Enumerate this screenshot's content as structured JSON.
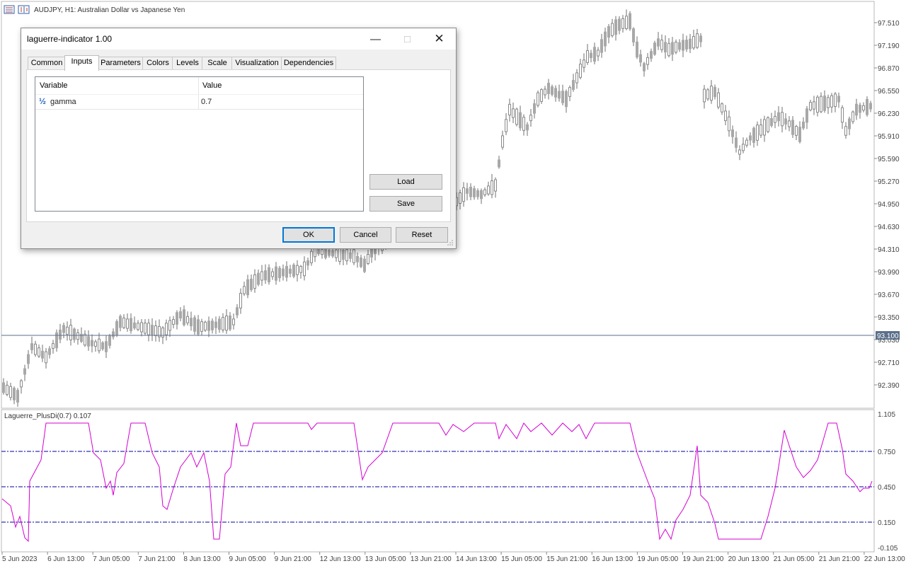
{
  "chart": {
    "title": "AUDJPY, H1:  Australian Dollar vs Japanese Yen",
    "price_levels": [
      "97.510",
      "97.190",
      "96.870",
      "96.550",
      "96.230",
      "95.910",
      "95.590",
      "95.270",
      "94.950",
      "94.630",
      "94.310",
      "93.990",
      "93.670",
      "93.350",
      "93.030",
      "92.710",
      "92.390"
    ],
    "current_price": "93.100",
    "indicator_label": "Laguerre_PlusDi(0.7) 0.107",
    "indicator_levels": [
      "1.105",
      "0.750",
      "0.450",
      "0.150",
      "-0.105"
    ],
    "time_labels": [
      "5 Jun 2023",
      "6 Jun 13:00",
      "7 Jun 05:00",
      "7 Jun 21:00",
      "8 Jun 13:00",
      "9 Jun 05:00",
      "9 Jun 21:00",
      "12 Jun 13:00",
      "13 Jun 05:00",
      "13 Jun 21:00",
      "14 Jun 13:00",
      "15 Jun 05:00",
      "15 Jun 21:00",
      "16 Jun 13:00",
      "19 Jun 05:00",
      "19 Jun 21:00",
      "20 Jun 13:00",
      "21 Jun 05:00",
      "21 Jun 21:00",
      "22 Jun 13:00"
    ],
    "colors": {
      "candle": "#a8a8a8",
      "indicator_line": "#d400d4",
      "level_line": "#00009c",
      "price_line": "#5a6f8a"
    }
  },
  "dialog": {
    "title": "laguerre-indicator 1.00",
    "tabs": [
      "Common",
      "Inputs",
      "Parameters",
      "Colors",
      "Levels",
      "Scale",
      "Visualization",
      "Dependencies"
    ],
    "active_tab": "Inputs",
    "table": {
      "headers": [
        "Variable",
        "Value"
      ],
      "rows": [
        {
          "icon": "½",
          "variable": "gamma",
          "value": "0.7"
        }
      ]
    },
    "load_label": "Load",
    "save_label": "Save",
    "ok_label": "OK",
    "cancel_label": "Cancel",
    "reset_label": "Reset"
  }
}
